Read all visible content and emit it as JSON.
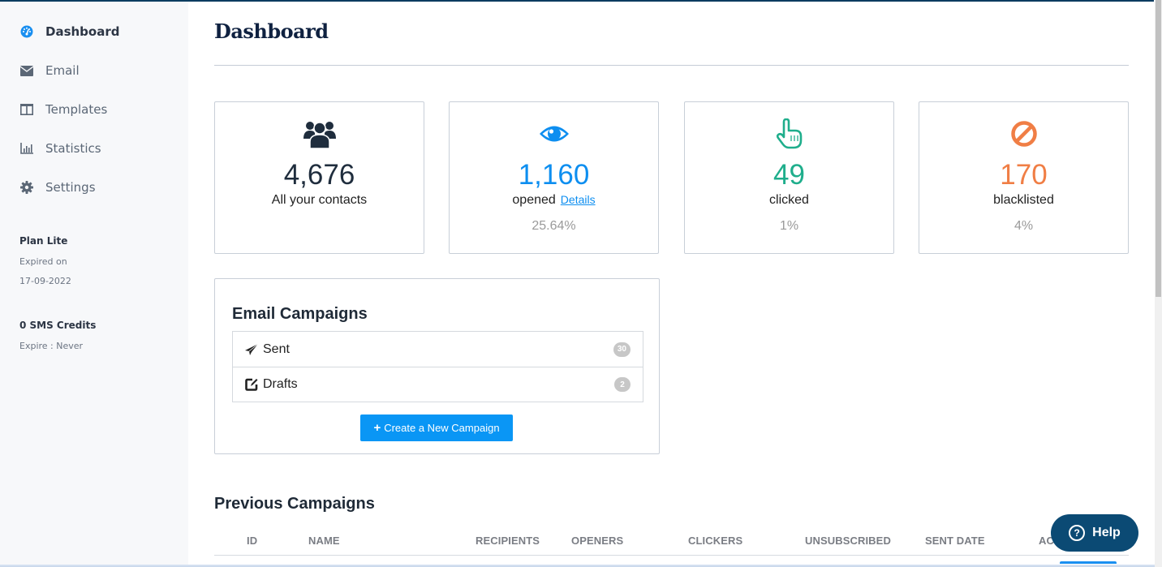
{
  "sidebar": {
    "items": [
      {
        "label": "Dashboard",
        "icon": "dashboard-gauge-icon",
        "active": true
      },
      {
        "label": "Email",
        "icon": "envelope-icon",
        "active": false
      },
      {
        "label": "Templates",
        "icon": "columns-icon",
        "active": false
      },
      {
        "label": "Statistics",
        "icon": "bar-chart-icon",
        "active": false
      },
      {
        "label": "Settings",
        "icon": "gear-icon",
        "active": false
      }
    ],
    "plan": {
      "title": "Plan Lite",
      "expired_label": "Expired on",
      "expired_date": "17-09-2022"
    },
    "sms": {
      "title": "0 SMS Credits",
      "expire": "Expire : Never"
    }
  },
  "header": {
    "title": "Dashboard"
  },
  "stats": [
    {
      "icon": "users-icon",
      "value": "4,676",
      "label": "All your contacts",
      "percent": "",
      "color": "#1f2d3d"
    },
    {
      "icon": "eye-icon",
      "value": "1,160",
      "label": "opened",
      "link": "Details",
      "percent": "25.64%",
      "color": "#0d8ef0"
    },
    {
      "icon": "pointer-hand-icon",
      "value": "49",
      "label": "clicked",
      "percent": "1%",
      "color": "#1fae8c"
    },
    {
      "icon": "ban-icon",
      "value": "170",
      "label": "blacklisted",
      "percent": "4%",
      "color": "#f07e45"
    }
  ],
  "campaigns": {
    "title": "Email Campaigns",
    "rows": [
      {
        "label": "Sent",
        "icon": "paper-plane-icon",
        "count": "30"
      },
      {
        "label": "Drafts",
        "icon": "edit-icon",
        "count": "2"
      }
    ],
    "create_button": {
      "icon": "+",
      "label": "Create a New Campaign"
    }
  },
  "previous": {
    "title": "Previous Campaigns",
    "columns": [
      "ID",
      "NAME",
      "RECIPIENTS",
      "OPENERS",
      "CLICKERS",
      "UNSUBSCRIBED",
      "SENT DATE",
      "AC"
    ]
  },
  "help": {
    "icon": "?",
    "label": "Help"
  },
  "colors": {
    "accent": "#0a96f5",
    "help": "#0b4a74",
    "sidebar_bg": "#f7f8fa"
  }
}
